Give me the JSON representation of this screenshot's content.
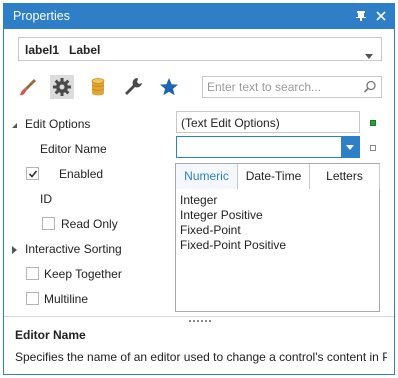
{
  "window": {
    "title": "Properties"
  },
  "object_selector": {
    "name": "label1",
    "type": "Label"
  },
  "search": {
    "placeholder": "Enter text to search..."
  },
  "toolbar": {
    "active": "settings"
  },
  "colors": {
    "accent": "#2e7fc8",
    "modified_marker": "#2e9e3c"
  },
  "properties": {
    "edit_options": {
      "label": "Edit Options",
      "value": "(Text Edit Options)",
      "expanded": true
    },
    "editor_name": {
      "label": "Editor Name",
      "value": ""
    },
    "enabled": {
      "label": "Enabled",
      "checked": true
    },
    "id": {
      "label": "ID"
    },
    "read_only": {
      "label": "Read Only",
      "checked": false
    },
    "interactive_sorting": {
      "label": "Interactive Sorting",
      "expanded": false
    },
    "keep_together": {
      "label": "Keep Together",
      "checked": false
    },
    "multiline": {
      "label": "Multiline",
      "checked": false
    }
  },
  "dropdown": {
    "tabs": [
      "Numeric",
      "Date-Time",
      "Letters"
    ],
    "active_tab": "Numeric",
    "items": [
      "Integer",
      "Integer Positive",
      "Fixed-Point",
      "Fixed-Point Positive"
    ]
  },
  "description": {
    "title": "Editor Name",
    "text": "Specifies the name of an editor used to change a control's content in Print..."
  }
}
